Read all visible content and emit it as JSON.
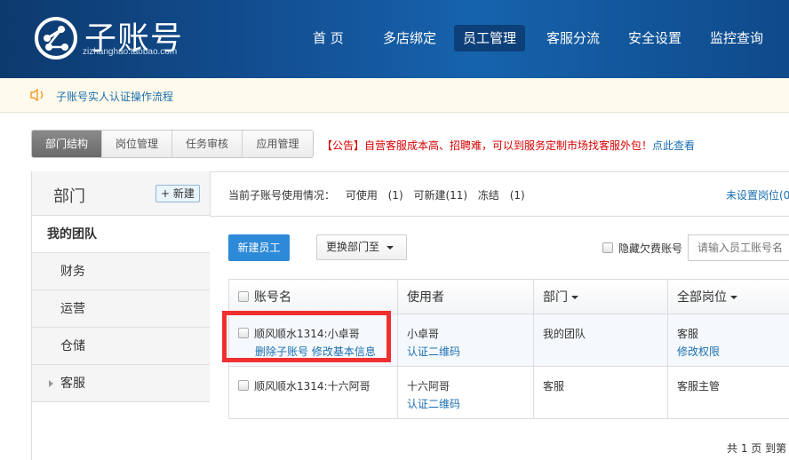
{
  "header": {
    "logo_text": "子账号",
    "logo_url": "zizhanghao.taobao.com",
    "nav": [
      "首 页",
      "多店绑定",
      "员工管理",
      "客服分流",
      "安全设置",
      "监控查询"
    ],
    "active_nav": 2
  },
  "notice": {
    "text": "子账号实人认证操作流程"
  },
  "tabs": [
    "部门结构",
    "岗位管理",
    "任务审核",
    "应用管理"
  ],
  "announcement": {
    "text": "【公告】自营客服成本高、招聘难，可以到服务定制市场找客服外包！",
    "link": "点此查看"
  },
  "sidebar": {
    "title": "部门",
    "new_button": "+ 新建",
    "items": [
      "我的团队",
      "财务",
      "运营",
      "仓储",
      "客服"
    ]
  },
  "status": {
    "text": "当前子账号使用情况： 可使用 (1)  可新建(11)  冻结 (1)",
    "unset_link": "未设置岗位(0"
  },
  "toolbar": {
    "new_employee": "新建员工",
    "move_dept": "更换部门至",
    "hide_label": "隐藏欠费账号",
    "search_placeholder": "请输入员工账号名"
  },
  "table": {
    "headers": [
      "账号名",
      "使用者",
      "部门",
      "全部岗位"
    ],
    "rows": [
      {
        "account": "顺风顺水1314:小卓哥",
        "account_links": "删除子账号 修改基本信息",
        "user": "小卓哥",
        "user_link": "认证二维码",
        "dept": "我的团队",
        "role": "客服",
        "role_link": "修改权限"
      },
      {
        "account": "顺风顺水1314:十六阿哥",
        "user": "十六阿哥",
        "user_link": "认证二维码",
        "dept": "客服",
        "role": "客服主管"
      }
    ]
  },
  "pager": {
    "text": "共 1 页 到第"
  }
}
